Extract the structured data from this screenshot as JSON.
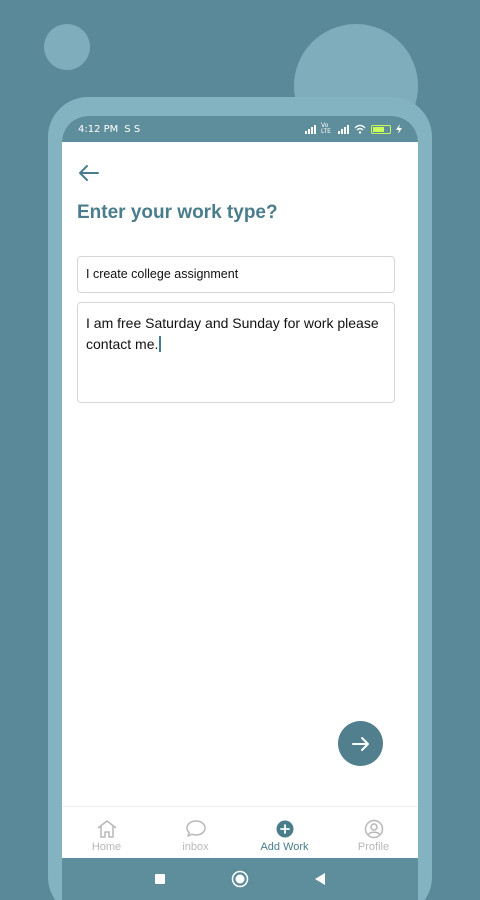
{
  "status_bar": {
    "time": "4:12 PM",
    "notif_icons": "S  S",
    "network_label": "Vo LTE",
    "battery_level": 0.6
  },
  "page": {
    "title": "Enter your work type?"
  },
  "form": {
    "work_type_value": "I create college assignment",
    "description_value": "I am free Saturday and Sunday for work please contact me."
  },
  "nav": {
    "items": [
      {
        "label": "Home",
        "icon": "home-icon",
        "active": false
      },
      {
        "label": "inbox",
        "icon": "chat-icon",
        "active": false
      },
      {
        "label": "Add Work",
        "icon": "add-circle-icon",
        "active": true
      },
      {
        "label": "Profile",
        "icon": "profile-icon",
        "active": false
      }
    ]
  },
  "colors": {
    "background": "#5a8a99",
    "accent": "#4a7d8c",
    "fab": "#517f8e"
  }
}
